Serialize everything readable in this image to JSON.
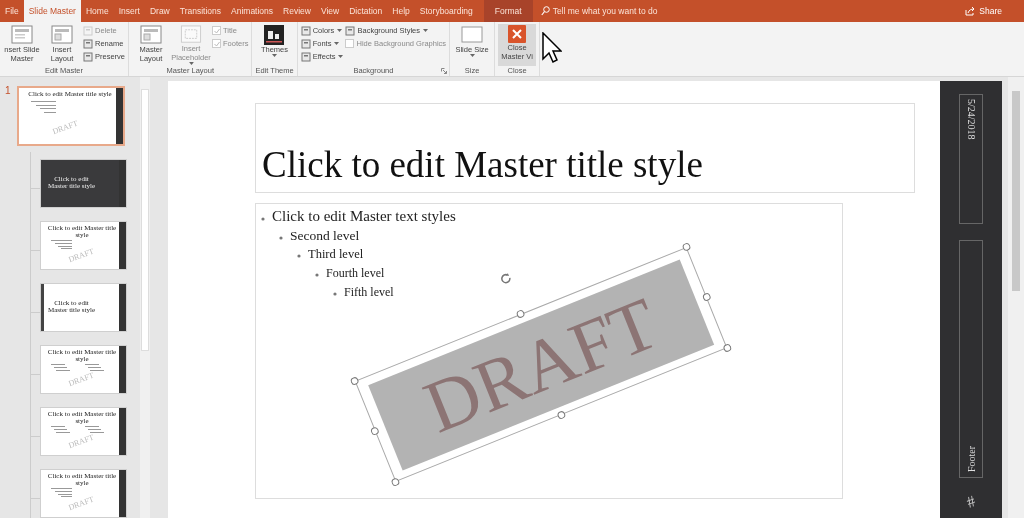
{
  "ribbon_tabs": [
    {
      "label": "File",
      "selected": false,
      "kind": "tab"
    },
    {
      "label": "Slide Master",
      "selected": true,
      "kind": "tab"
    },
    {
      "label": "Home",
      "selected": false,
      "kind": "tab"
    },
    {
      "label": "Insert",
      "selected": false,
      "kind": "tab"
    },
    {
      "label": "Draw",
      "selected": false,
      "kind": "tab"
    },
    {
      "label": "Transitions",
      "selected": false,
      "kind": "tab"
    },
    {
      "label": "Animations",
      "selected": false,
      "kind": "tab"
    },
    {
      "label": "Review",
      "selected": false,
      "kind": "tab"
    },
    {
      "label": "View",
      "selected": false,
      "kind": "tab"
    },
    {
      "label": "Dictation",
      "selected": false,
      "kind": "tab"
    },
    {
      "label": "Help",
      "selected": false,
      "kind": "tab"
    },
    {
      "label": "Storyboarding",
      "selected": false,
      "kind": "tab"
    },
    {
      "label": "Format",
      "selected": false,
      "kind": "contextual"
    }
  ],
  "search": {
    "placeholder": "Tell me what you want to do"
  },
  "share": "Share",
  "ribbon_groups": [
    {
      "label": "Edit Master",
      "launcher": false,
      "items": [
        {
          "kind": "large",
          "label": "nsert Slide Master",
          "disabled": false,
          "dropdown": false,
          "highlighted": false
        },
        {
          "kind": "large",
          "label": "Insert Layout",
          "disabled": false,
          "dropdown": false,
          "highlighted": false
        },
        {
          "kind": "stack",
          "items": [
            {
              "kind": "small",
              "label": "Delete",
              "disabled": true,
              "dropdown": false
            },
            {
              "kind": "small",
              "label": "Rename",
              "disabled": false,
              "dropdown": false
            },
            {
              "kind": "small",
              "label": "Preserve",
              "disabled": false,
              "dropdown": false
            }
          ]
        }
      ]
    },
    {
      "label": "Master Layout",
      "launcher": false,
      "items": [
        {
          "kind": "large",
          "label": "Master Layout",
          "disabled": false,
          "dropdown": false,
          "highlighted": false
        },
        {
          "kind": "large",
          "label": "Insert Placeholder",
          "disabled": true,
          "dropdown": true,
          "highlighted": false
        },
        {
          "kind": "stack",
          "items": [
            {
              "kind": "check",
              "label": "Title",
              "checked": true,
              "disabled": true
            },
            {
              "kind": "check",
              "label": "Footers",
              "checked": true,
              "disabled": true
            }
          ]
        }
      ]
    },
    {
      "label": "Edit Theme",
      "launcher": false,
      "items": [
        {
          "kind": "large",
          "label": "Themes",
          "disabled": false,
          "dropdown": true,
          "highlighted": false
        }
      ]
    },
    {
      "label": "Background",
      "launcher": true,
      "items": [
        {
          "kind": "stack",
          "items": [
            {
              "kind": "small",
              "label": "Colors",
              "disabled": false,
              "dropdown": true
            },
            {
              "kind": "small",
              "label": "Fonts",
              "disabled": false,
              "dropdown": true
            },
            {
              "kind": "small",
              "label": "Effects",
              "disabled": false,
              "dropdown": true
            }
          ]
        },
        {
          "kind": "stack",
          "items": [
            {
              "kind": "small",
              "label": "Background Styles",
              "disabled": false,
              "dropdown": true
            },
            {
              "kind": "check",
              "label": "Hide Background Graphics",
              "checked": false,
              "disabled": true
            }
          ]
        }
      ]
    },
    {
      "label": "Size",
      "launcher": false,
      "items": [
        {
          "kind": "large",
          "label": "Slide Size",
          "disabled": false,
          "dropdown": true,
          "highlighted": false
        }
      ]
    },
    {
      "label": "Close",
      "launcher": false,
      "items": [
        {
          "kind": "large",
          "label": "Close Master Vi",
          "disabled": false,
          "dropdown": false,
          "highlighted": true
        }
      ]
    }
  ],
  "thumbnails": {
    "number": "1",
    "items": [
      {
        "kind": "master",
        "title": "Click to edit Master title style",
        "watermark": "DRAFT",
        "selected": true
      },
      {
        "kind": "title",
        "title": "Click to edit Master title style",
        "selected": false
      },
      {
        "kind": "content",
        "title": "Click to edit Master title style",
        "watermark": "DRAFT",
        "selected": false
      },
      {
        "kind": "section",
        "title": "Click to edit Master title style",
        "selected": false
      },
      {
        "kind": "two",
        "title": "Click to edit Master title style",
        "watermark": "DRAFT",
        "selected": false
      },
      {
        "kind": "two",
        "title": "Click to edit Master title style",
        "watermark": "DRAFT",
        "selected": false
      },
      {
        "kind": "content",
        "title": "Click to edit Master title style",
        "watermark": "DRAFT",
        "selected": false
      }
    ]
  },
  "slide": {
    "title": "Click to edit Master title style",
    "bullets": [
      {
        "text": "Click to edit Master text styles",
        "children": [
          {
            "text": "Second level",
            "children": [
              {
                "text": "Third level",
                "children": [
                  {
                    "text": "Fourth level",
                    "children": [
                      {
                        "text": "Fifth level"
                      }
                    ]
                  }
                ]
              }
            ]
          }
        ]
      }
    ],
    "watermark": "DRAFT",
    "date": "5/24/2018",
    "footer": "Footer",
    "slide_number": "#"
  }
}
